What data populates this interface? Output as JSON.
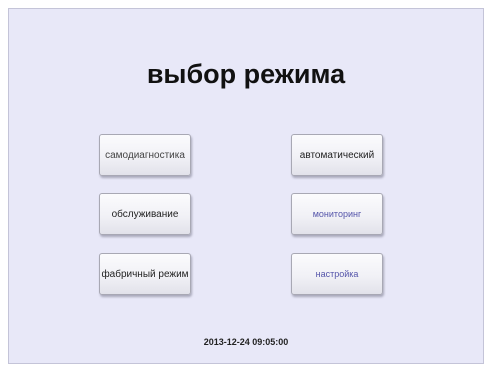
{
  "screen": {
    "title": "выбор режима",
    "datetime": "2013-12-24  09:05:00"
  },
  "buttons": {
    "self_diagnostics": "самодиагностика",
    "maintenance": "обслуживание",
    "factory_mode": "фабричный режим",
    "automatic": "автоматический",
    "monitoring": "мониторинг",
    "settings": "настройка"
  },
  "colors": {
    "background": "#e8e8f8",
    "text": "#222222",
    "accent_text": "#3a3acc"
  }
}
